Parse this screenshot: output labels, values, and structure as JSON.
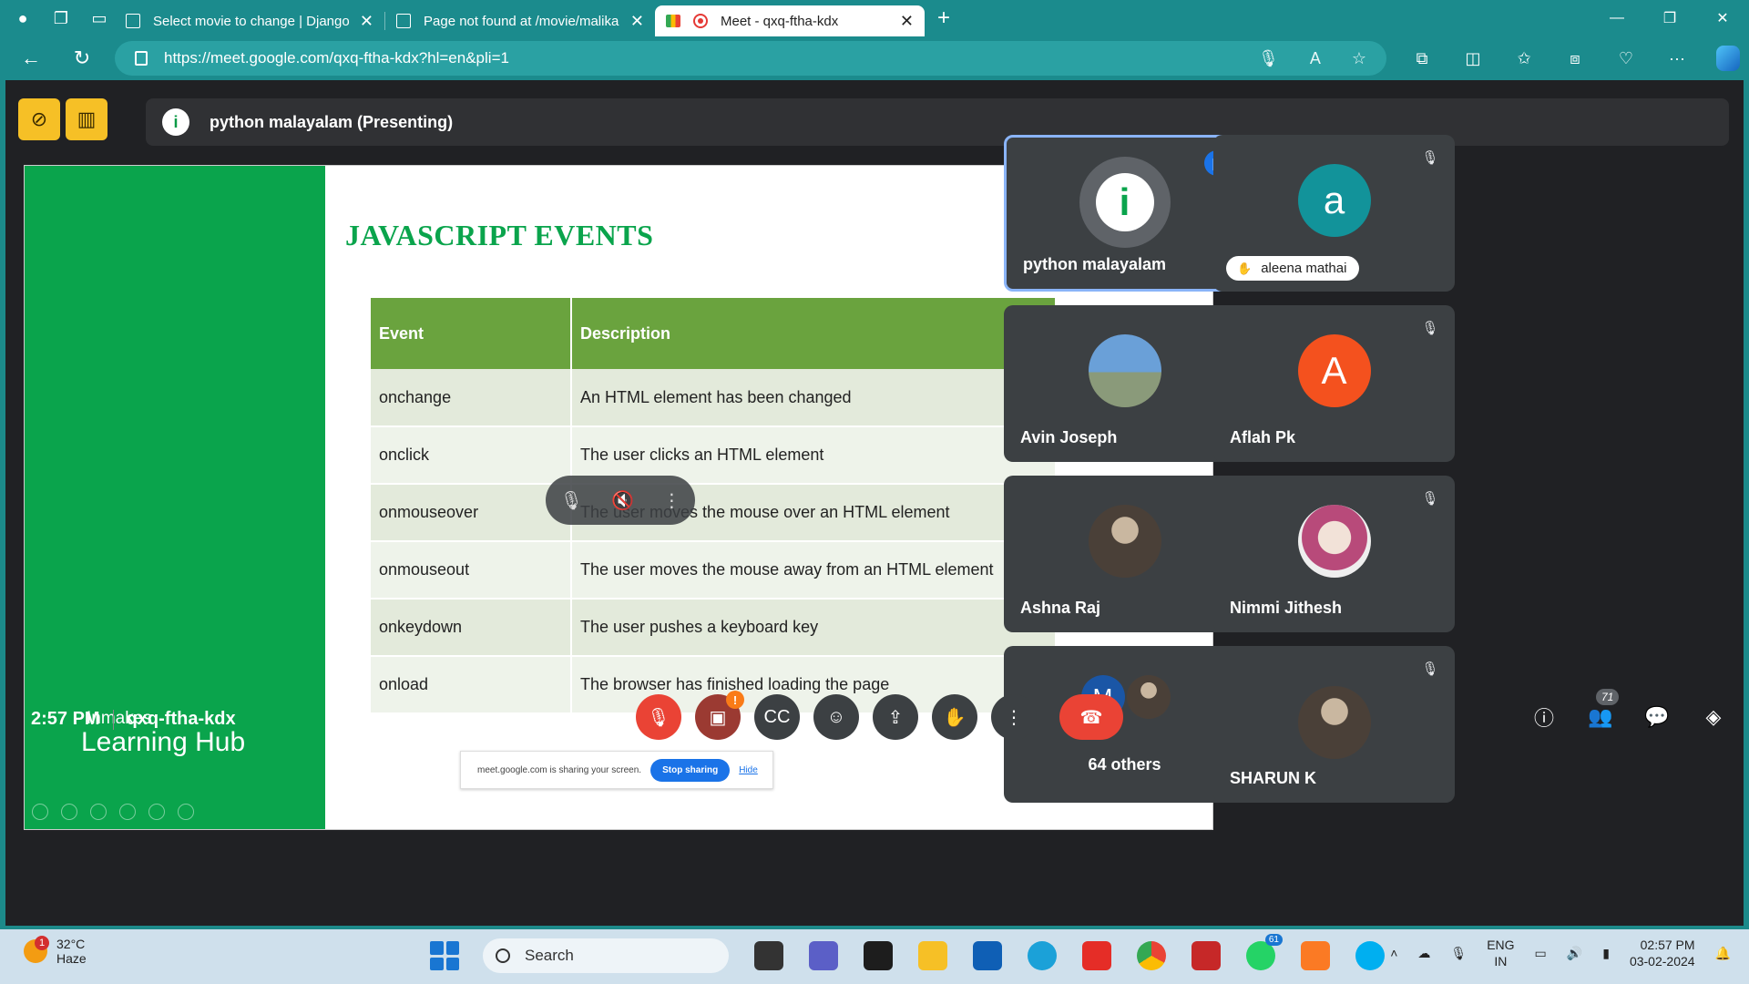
{
  "browser": {
    "tabs": [
      {
        "title": "Select movie to change | Django"
      },
      {
        "title": "Page not found at /movie/malika"
      },
      {
        "title": "Meet - qxq-ftha-kdx"
      }
    ],
    "url": "https://meet.google.com/qxq-ftha-kdx?hl=en&pli=1"
  },
  "meet": {
    "presenting": "python malayalam (Presenting)",
    "slide": {
      "title": "JAVASCRIPT EVENTS",
      "headers": [
        "Event",
        "Description"
      ],
      "rows": [
        [
          "onchange",
          "An HTML element has been changed"
        ],
        [
          "onclick",
          "The user clicks an HTML element"
        ],
        [
          "onmouseover",
          "The user moves the mouse over an HTML element"
        ],
        [
          "onmouseout",
          "The user moves the mouse away from an HTML element"
        ],
        [
          "onkeydown",
          "The user pushes a keyboard key"
        ],
        [
          "onload",
          "The browser has finished loading the page"
        ]
      ],
      "logo_line1": "Inmakes",
      "logo_line2": "Learning Hub",
      "share_notice": "meet.google.com is sharing your screen.",
      "stop_sharing": "Stop sharing",
      "hide": "Hide"
    },
    "participants": [
      {
        "name": "python malayalam",
        "initial": "i"
      },
      {
        "name": "aleena mathai",
        "initial": "a"
      },
      {
        "name": "Avin Joseph"
      },
      {
        "name": "Aflah Pk",
        "initial": "A"
      },
      {
        "name": "Ashna Raj"
      },
      {
        "name": "Nimmi Jithesh"
      },
      {
        "name": "64 others",
        "initial": "M"
      },
      {
        "name": "SHARUN K"
      }
    ],
    "time": "2:57 PM",
    "meeting_code": "qxq-ftha-kdx",
    "people_count": "71",
    "camera_warning": "!"
  },
  "taskbar": {
    "temperature": "32°C",
    "weather": "Haze",
    "weather_badge": "1",
    "search_placeholder": "Search",
    "whatsapp_count": "61",
    "lang1": "ENG",
    "lang2": "IN",
    "time": "02:57 PM",
    "date": "03-02-2024"
  }
}
